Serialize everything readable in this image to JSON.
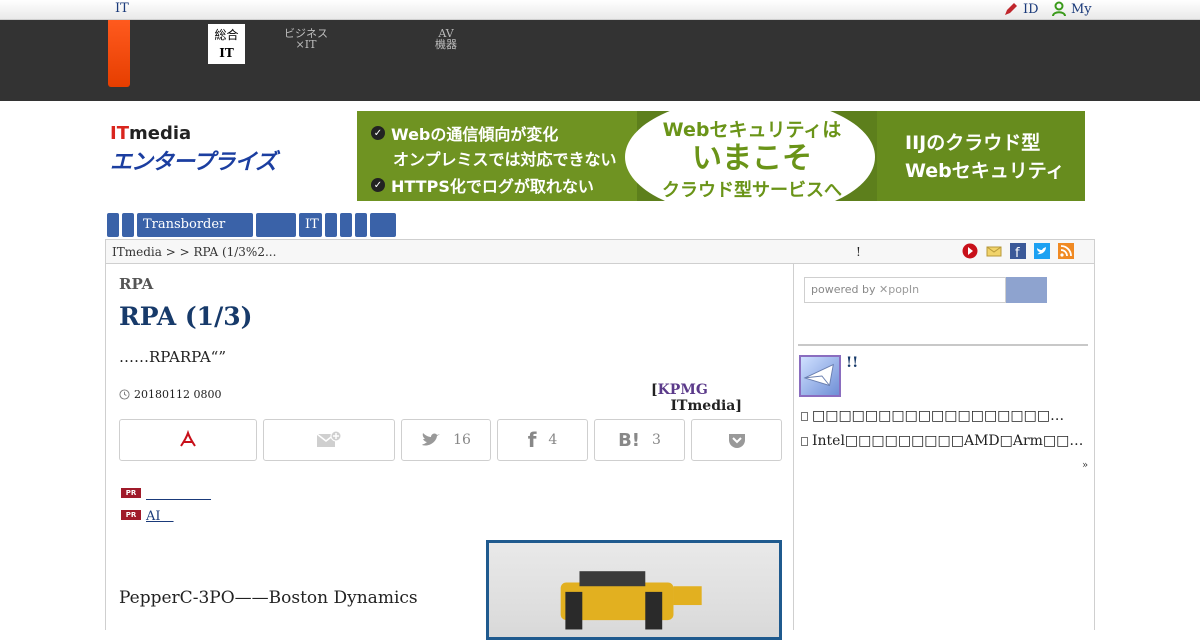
{
  "topbar": {
    "brand": "IT",
    "id_label": "ID",
    "my_label": "My"
  },
  "darknav": {
    "selected": {
      "line1": "総合",
      "line2": "IT"
    },
    "items": [
      {
        "line1": "ビジネス",
        "line2": "×IT"
      },
      {
        "line1": "AV",
        "line2": "機器"
      }
    ]
  },
  "logo": {
    "it": "IT",
    "media": "media",
    "enterprise": "エンタープライズ"
  },
  "ad": {
    "left_lines": [
      "Webの通信傾向が変化",
      "オンプレミスでは対応できない",
      "HTTPS化でログが取れない"
    ],
    "mid_lines": [
      "Webセキュリティは",
      "いまこそ",
      "クラウド型サービスへ"
    ],
    "right_lines": [
      "IIJのクラウド型",
      "Webセキュリティ"
    ]
  },
  "menu": [
    "",
    "",
    "Transborder",
    "",
    "IT",
    "",
    "",
    "",
    ""
  ],
  "breadcrumb": {
    "path": "ITmedia  >   > RPA (1/3%2...",
    "bang": "!"
  },
  "article": {
    "kicker": "RPA",
    "title": "RPA (1/3)",
    "lead": "……RPARPA“”",
    "date": "20180112 0800",
    "byline_open": "[",
    "byline_org": "KPMG",
    "byline_media": "ITmedia]",
    "share": {
      "twitter_count": "16",
      "facebook_count": "4",
      "hatena_count": "3"
    },
    "pr": [
      {
        "tag": "PR",
        "text": "　　　　　"
      },
      {
        "tag": "PR",
        "text": "AI　"
      }
    ],
    "paragraph": "PepperC-3PO——Boston Dynamics"
  },
  "sidebar": {
    "search_placeholder_prefix": "powered by",
    "search_placeholder_brand": "popIn",
    "mail_title": "!!",
    "news": [
      "□□□□□□□□□□□□□□□□□□…",
      "Intel□□□□□□□□□AMD□Arm□□…"
    ],
    "more": "»"
  },
  "colors": {
    "accent": "#e63e00",
    "nav_blue": "#3a62a8",
    "title_blue": "#173a6a",
    "dark_nav": "#333333"
  }
}
